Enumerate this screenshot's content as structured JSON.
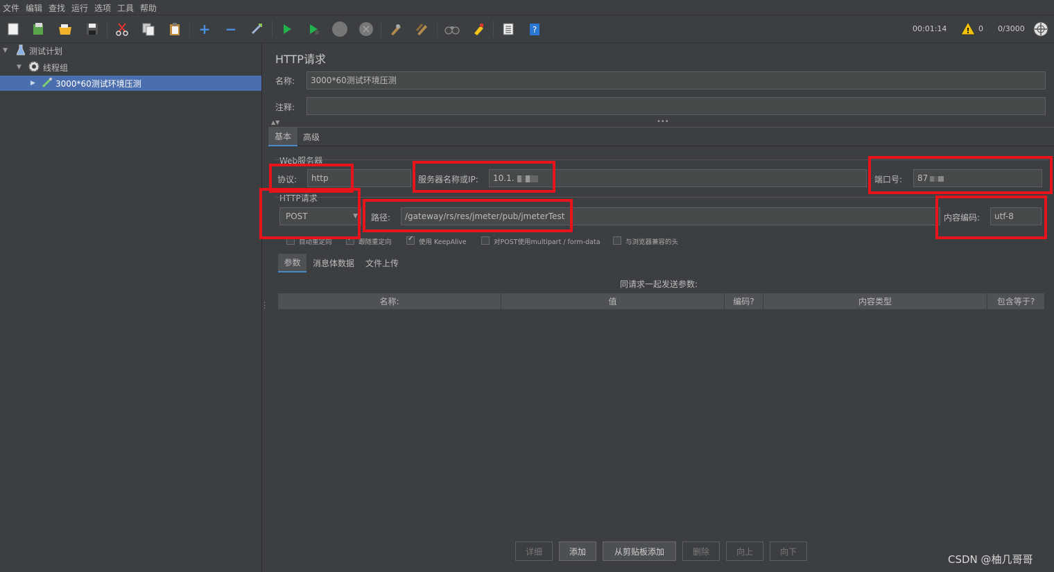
{
  "menu": [
    "文件",
    "编辑",
    "查找",
    "运行",
    "选项",
    "工具",
    "帮助"
  ],
  "toolbar": {
    "icons": [
      "new-icon",
      "templates-icon",
      "open-icon",
      "save-icon",
      "cut-icon",
      "copy-icon",
      "paste-icon",
      "expand-icon",
      "collapse-icon",
      "toggle-icon",
      "start-icon",
      "start-no-pause-icon",
      "stop-icon",
      "shutdown-icon",
      "clear-icon",
      "clear-all-icon",
      "search-icon",
      "reset-search-icon",
      "function-helper-icon",
      "help-icon"
    ],
    "elapsed": "00:01:14",
    "warnings": "0",
    "threads": "0/3000"
  },
  "tree": {
    "items": [
      {
        "label": "测试计划"
      },
      {
        "label": "线程组"
      },
      {
        "label": "3000*60测试环境压测"
      }
    ]
  },
  "panel": {
    "title": "HTTP请求",
    "name_label": "名称:",
    "name_value": "3000*60测试环境压测",
    "comment_label": "注释:",
    "comment_value": "",
    "tabs": [
      "基本",
      "高级"
    ],
    "web_server_section": "Web服务器",
    "protocol_label": "协议:",
    "protocol_value": "http",
    "server_label": "服务器名称或IP:",
    "server_value": "10.1.",
    "port_label": "端口号:",
    "port_value": "87",
    "http_section": "HTTP请求",
    "method": "POST",
    "path_label": "路径:",
    "path_value": "/gateway/rs/res/jmeter/pub/jmeterTest",
    "encoding_label": "内容编码:",
    "encoding_value": "utf-8",
    "checkboxes": [
      {
        "label": "自动重定向",
        "checked": false
      },
      {
        "label": "跟随重定向",
        "checked": true
      },
      {
        "label": "使用 KeepAlive",
        "checked": true
      },
      {
        "label": "对POST使用multipart / form-data",
        "checked": false
      },
      {
        "label": "与浏览器兼容的头",
        "checked": false
      }
    ],
    "sub_tabs": [
      "参数",
      "消息体数据",
      "文件上传"
    ],
    "params_caption": "同请求一起发送参数:",
    "columns": [
      "名称:",
      "值",
      "编码?",
      "内容类型",
      "包含等于?"
    ],
    "buttons": [
      "详细",
      "添加",
      "从剪贴板添加",
      "删除",
      "向上",
      "向下"
    ]
  },
  "watermark": "CSDN @柚几哥哥",
  "colors": {
    "highlight_box": "#e8141c",
    "selection": "#4b6eaf",
    "background": "#3c3f41"
  }
}
